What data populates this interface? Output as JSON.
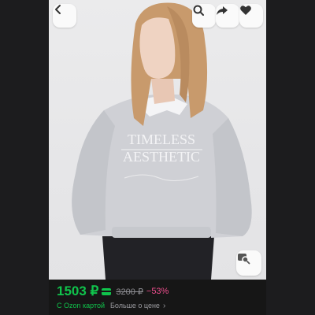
{
  "product": {
    "image_alt": "Girl in grey TIMELESS AESTHETIC sweatshirt",
    "print_lines": [
      "TIMELESS",
      "AESTHETIC"
    ],
    "price": "1503 ₽",
    "old_price": "3200 ₽",
    "discount": "−53%"
  },
  "promo": {
    "card_label": "С Ozon картой",
    "more_label": "Больше о цене",
    "chevron": "›"
  },
  "icons": {
    "back": "chevron-left-icon",
    "search": "search-icon",
    "share": "share-icon",
    "favorite": "heart-icon",
    "similar": "visual-search-icon"
  },
  "colors": {
    "price": "#10c44c",
    "discount": "#f04f8f",
    "background": "#161616"
  }
}
